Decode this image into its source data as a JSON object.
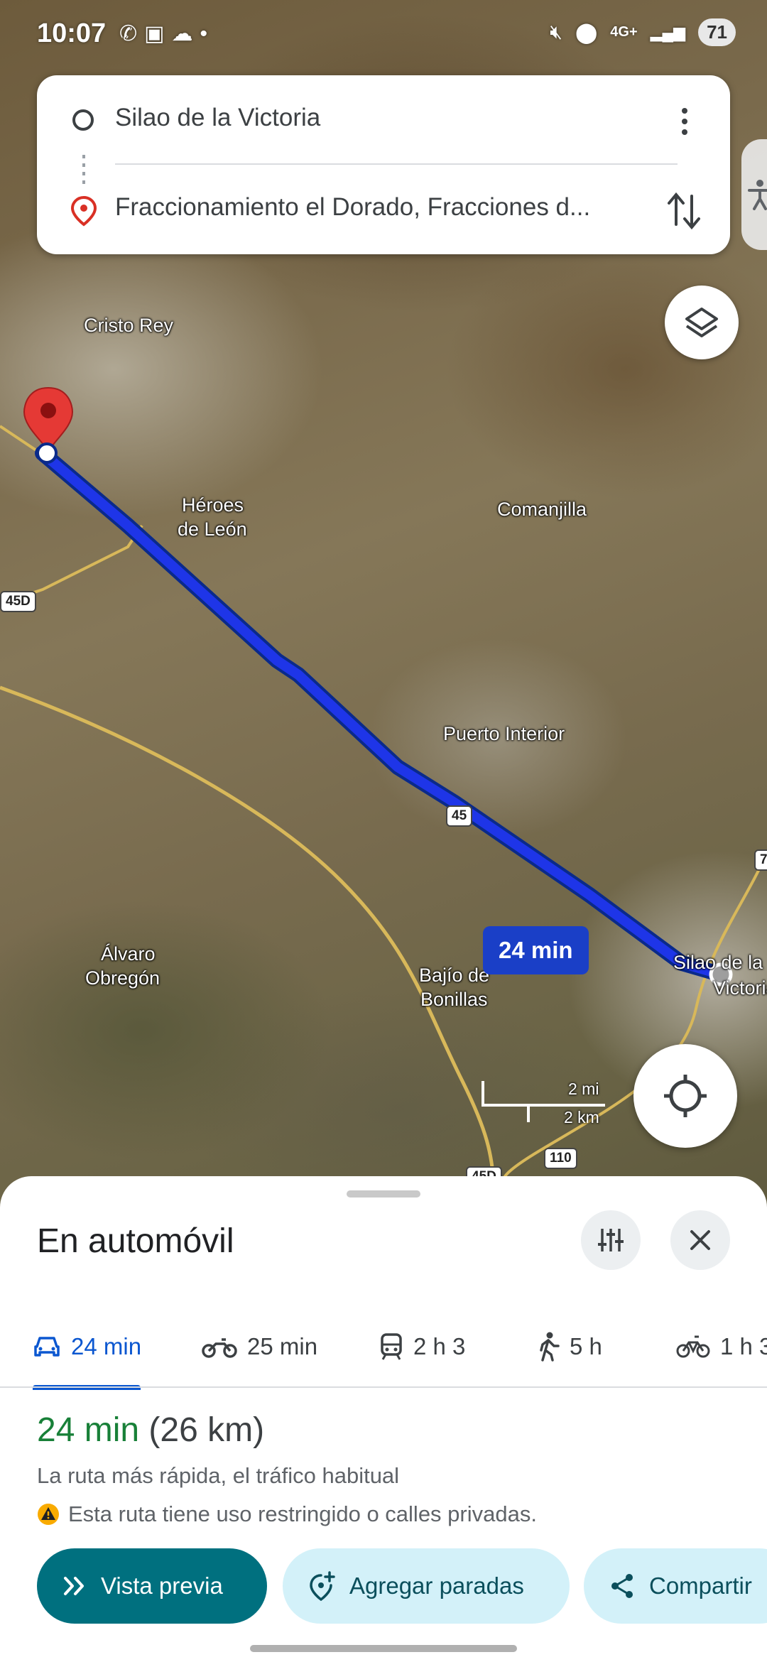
{
  "status_bar": {
    "time": "10:07",
    "left_icons": [
      "whatsapp-icon",
      "camera-icon",
      "cloud-icon",
      "dot-icon"
    ],
    "network": "4G+",
    "battery": "71"
  },
  "route_card": {
    "origin": "Silao de la Victoria",
    "destination": "Fraccionamiento el Dorado, Fracciones d..."
  },
  "map": {
    "places": {
      "cristo_rey": "Cristo Rey",
      "heroes_1": "Héroes",
      "heroes_2": "de León",
      "comanjilla": "Comanjilla",
      "puerto_interior": "Puerto Interior",
      "alvaro_1": "Álvaro",
      "alvaro_2": "Obregón",
      "bajio_1": "Bajío de",
      "bajio_2": "Bonillas",
      "silao_1": "Silao de la",
      "silao_2": "Victoria"
    },
    "shields": {
      "s45d": "45D",
      "s45": "45",
      "s110": "110",
      "s7": "7",
      "s45d_bottom": "45D"
    },
    "route_time": "24 min",
    "route_color": "#1a3fc7",
    "scale": {
      "mi": "2 mi",
      "km": "2 km"
    }
  },
  "sheet": {
    "title": "En automóvil",
    "modes": [
      {
        "icon": "car-icon",
        "label": "24 min"
      },
      {
        "icon": "motorcycle-icon",
        "label": "25 min"
      },
      {
        "icon": "transit-icon",
        "label": "2 h 3"
      },
      {
        "icon": "walk-icon",
        "label": "5 h"
      },
      {
        "icon": "bike-icon",
        "label": "1 h 3"
      }
    ],
    "summary": {
      "duration": "24 min",
      "distance": "(26 km)"
    },
    "description": "La ruta más rápida, el tráfico habitual",
    "warning": "Esta ruta tiene uso restringido o calles privadas.",
    "actions": {
      "preview": "Vista previa",
      "add_stops": "Agregar paradas",
      "share": "Compartir"
    }
  },
  "colors": {
    "accent": "#0b57d0",
    "duration_green": "#188038",
    "teal": "#00707f",
    "light_teal": "#d3f1f9"
  }
}
